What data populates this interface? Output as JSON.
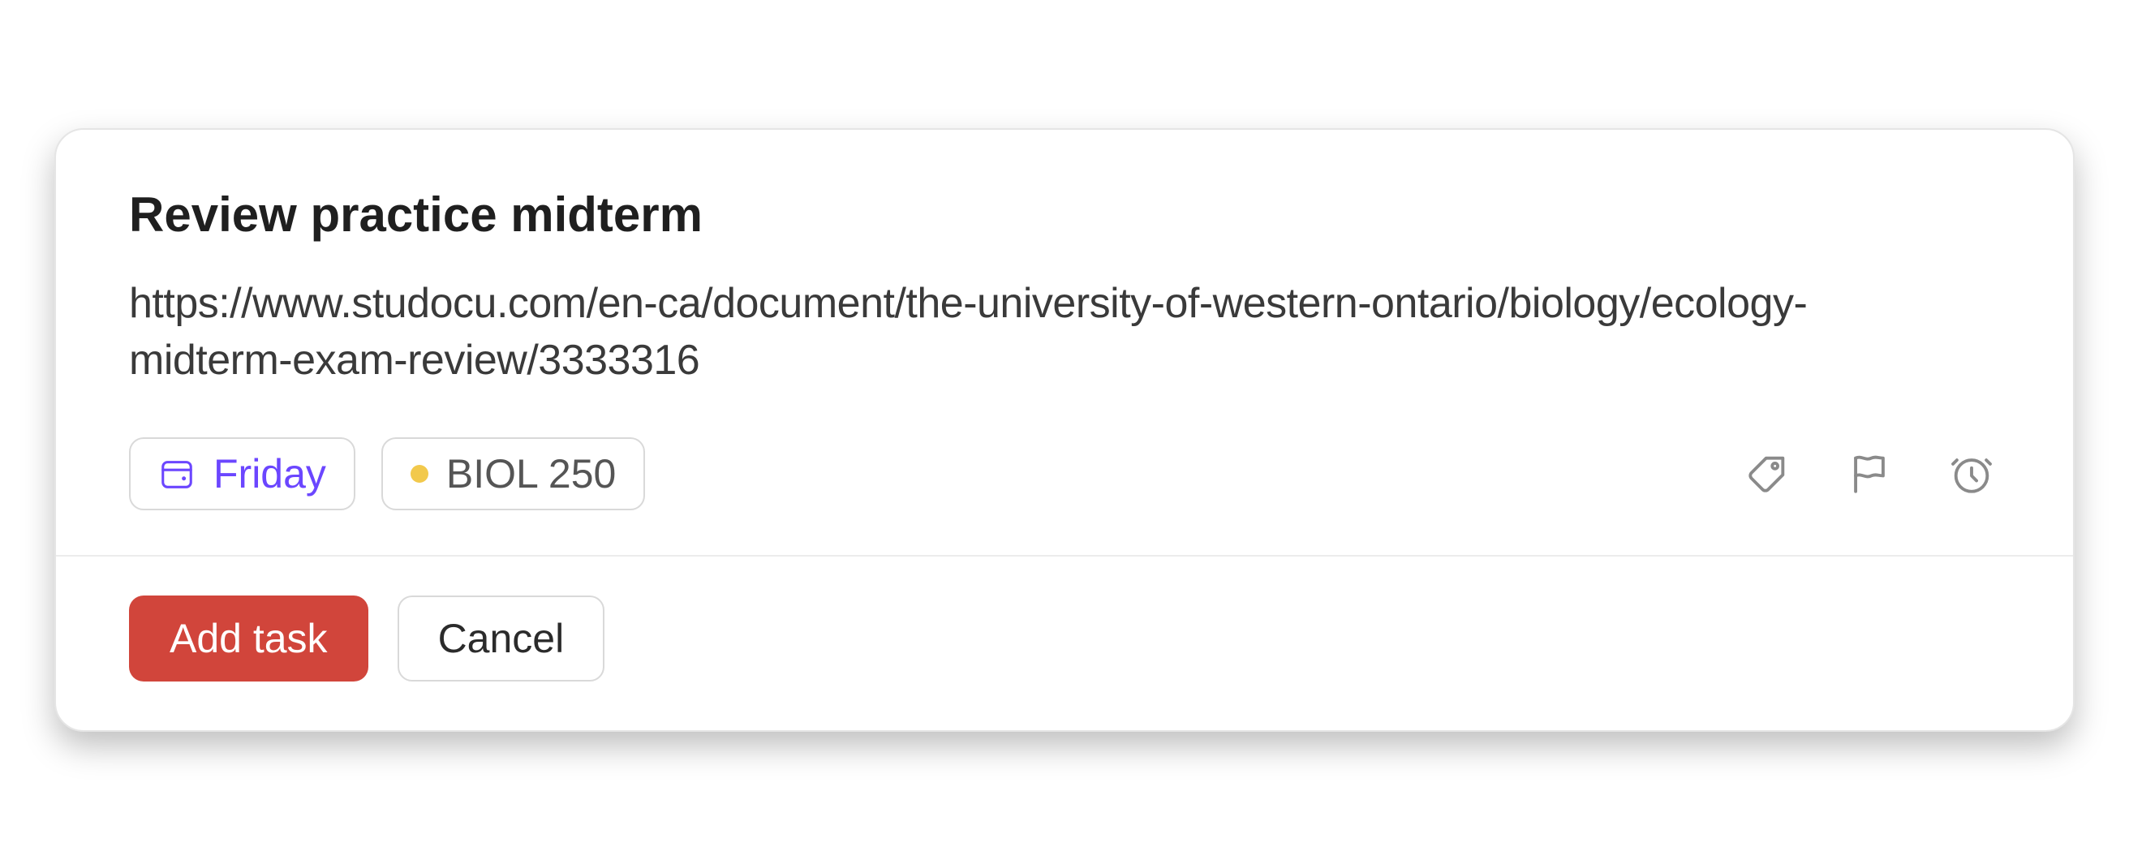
{
  "task": {
    "title": "Review practice midterm",
    "description": "https://www.studocu.com/en-ca/document/the-university-of-western-ontario/biology/ecology-midterm-exam-review/3333316"
  },
  "pills": {
    "date_label": "Friday",
    "project_label": "BIOL 250",
    "project_dot_color": "#f2c94c"
  },
  "icons": {
    "date": "calendar-icon",
    "label": "tag-icon",
    "priority": "flag-icon",
    "reminder": "alarm-icon"
  },
  "buttons": {
    "add_task": "Add task",
    "cancel": "Cancel"
  },
  "colors": {
    "primary_button_bg": "#d1453b",
    "date_text": "#6b46ff"
  }
}
